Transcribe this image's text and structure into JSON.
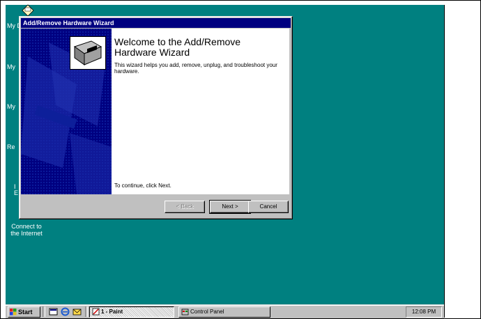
{
  "desktop": {
    "labels": [
      "My D",
      "My",
      "My",
      "Re",
      "I",
      "E",
      "Connect to",
      "the Internet"
    ]
  },
  "wizard": {
    "title_bar": "Add/Remove Hardware Wizard",
    "heading": "Welcome to the Add/Remove Hardware Wizard",
    "description": "This wizard helps you add, remove, unplug, and troubleshoot your hardware.",
    "continue_text": "To continue, click Next.",
    "back_label": "< Back",
    "next_label": "Next >",
    "cancel_label": "Cancel",
    "icon": "hardware-card-icon"
  },
  "taskbar": {
    "start_label": "Start",
    "quick_launch_icons": [
      "desktop-icon",
      "internet-explorer-icon",
      "outlook-icon"
    ],
    "tasks": [
      {
        "label": "1 - Paint",
        "icon": "paint-icon",
        "active": true
      },
      {
        "label": "Control Panel",
        "icon": "control-panel-icon",
        "active": false
      }
    ],
    "clock": "12:08 PM"
  },
  "colors": {
    "desktop": "#008080",
    "titlebar": "#000080",
    "window": "#c0c0c0"
  }
}
